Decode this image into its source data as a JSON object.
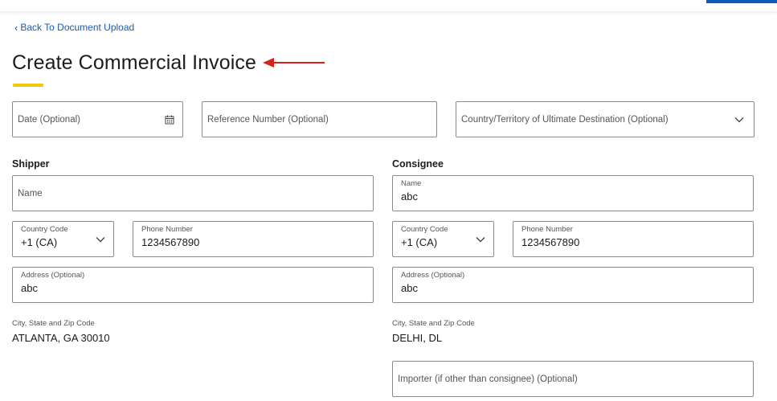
{
  "nav": {
    "back_label": "Back To Document Upload"
  },
  "page": {
    "title": "Create Commercial Invoice"
  },
  "top_fields": {
    "date_placeholder": "Date (Optional)",
    "reference_placeholder": "Reference Number (Optional)",
    "destination_placeholder": "Country/Territory of Ultimate Destination (Optional)"
  },
  "shipper": {
    "heading": "Shipper",
    "name_placeholder": "Name",
    "country_code_label": "Country Code",
    "country_code_value": "+1 (CA)",
    "phone_label": "Phone Number",
    "phone_value": "1234567890",
    "address_label": "Address (Optional)",
    "address_value": "abc",
    "city_label": "City, State and Zip Code",
    "city_value": "ATLANTA, GA 30010"
  },
  "consignee": {
    "heading": "Consignee",
    "name_label": "Name",
    "name_value": "abc",
    "country_code_label": "Country Code",
    "country_code_value": "+1 (CA)",
    "phone_label": "Phone Number",
    "phone_value": "1234567890",
    "address_label": "Address (Optional)",
    "address_value": "abc",
    "city_label": "City, State and Zip Code",
    "city_value": "DELHI, DL",
    "importer_placeholder": "Importer (if other than consignee) (Optional)"
  },
  "colors": {
    "link": "#1e5aa8",
    "accent_yellow": "#f2c80f",
    "annotation_red": "#d9211c",
    "brand_blue": "#0a5cb8"
  }
}
